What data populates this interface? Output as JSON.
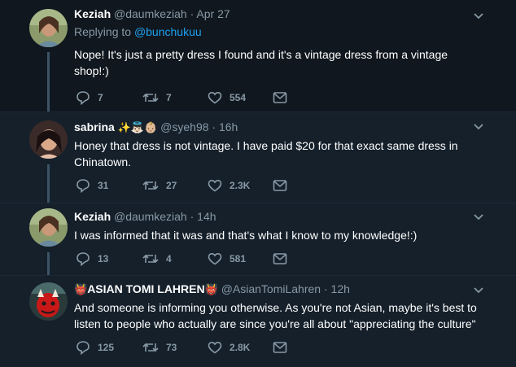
{
  "tweets": [
    {
      "name": "Keziah",
      "handle": "@daumkeziah",
      "sep": "·",
      "time": "Apr 27",
      "replying_prefix": "Replying to",
      "replying_to": "@bunchukuu",
      "text": "Nope! It's just a pretty dress I found and it's a vintage dress from a vintage shop!:)",
      "replies": "7",
      "retweets": "7",
      "likes": "554"
    },
    {
      "name": "sabrina",
      "name_emoji": "✨👼🏻👶🏼",
      "handle": "@syeh98",
      "sep": "·",
      "time": "16h",
      "text": "Honey that dress is not vintage. I have paid $20 for that exact same dress in Chinatown.",
      "replies": "31",
      "retweets": "27",
      "likes": "2.3K"
    },
    {
      "name": "Keziah",
      "handle": "@daumkeziah",
      "sep": "·",
      "time": "14h",
      "text": "I was informed that it was and that's what I know to my knowledge!:)",
      "replies": "13",
      "retweets": "4",
      "likes": "581"
    },
    {
      "name_emoji_left": "👹",
      "name": "ASIAN TOMI LAHREN",
      "name_emoji_right": "👹",
      "handle": "@AsianTomiLahren",
      "sep": "·",
      "time": "12h",
      "text": "And someone is informing you otherwise. As you're not Asian, maybe it's best to listen to people who actually are since you're all about \"appreciating the culture\"",
      "replies": "125",
      "retweets": "73",
      "likes": "2.8K"
    }
  ],
  "colors": {
    "background": "#15202b",
    "focused_background": "#10171e",
    "secondary_text": "#8899a6",
    "link": "#1da1f2",
    "thread_line": "#3d5466"
  }
}
